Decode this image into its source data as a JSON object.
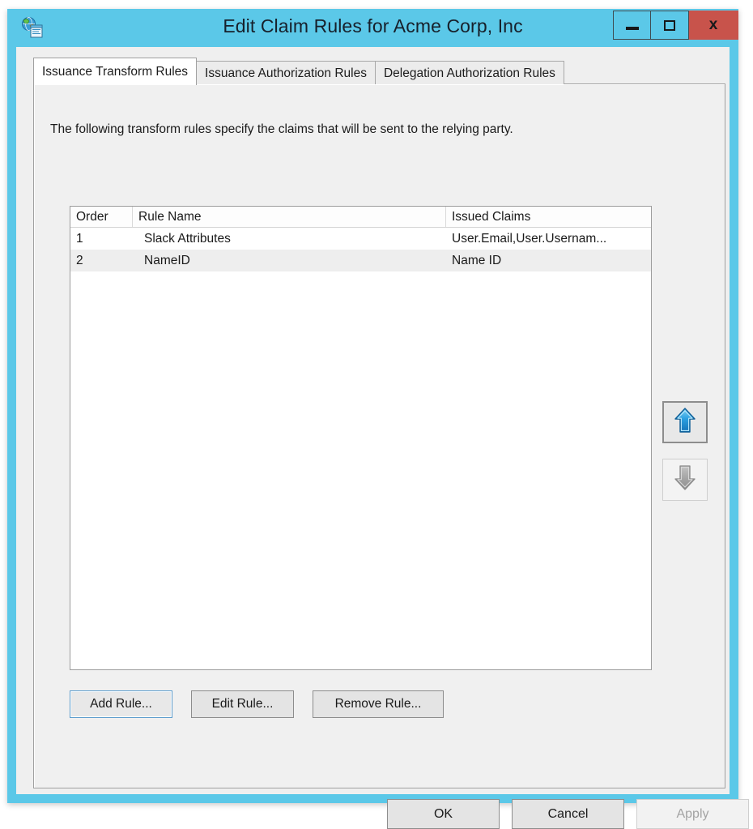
{
  "window": {
    "title": "Edit Claim Rules for Acme Corp, Inc",
    "icon": "relying-party-trust-icon",
    "accent_color": "#5bc8e8",
    "close_button_color": "#c8534b",
    "caption": {
      "minimize_label": "–",
      "maximize_label": "□",
      "close_label": "x"
    }
  },
  "tabs": [
    {
      "label": "Issuance Transform Rules",
      "active": true
    },
    {
      "label": "Issuance Authorization Rules",
      "active": false
    },
    {
      "label": "Delegation Authorization Rules",
      "active": false
    }
  ],
  "page": {
    "intro": "The following transform rules specify the claims that will be sent to the relying party."
  },
  "listview": {
    "columns": [
      {
        "key": "order",
        "label": "Order"
      },
      {
        "key": "name",
        "label": "Rule Name"
      },
      {
        "key": "claims",
        "label": "Issued Claims"
      }
    ],
    "rows": [
      {
        "order": "1",
        "name": "Slack Attributes",
        "claims": "User.Email,User.Usernam...",
        "selected": false
      },
      {
        "order": "2",
        "name": "NameID",
        "claims": "Name ID",
        "selected": true
      }
    ],
    "selection_color": "#eeeeee"
  },
  "order_controls": {
    "move_up": {
      "icon": "arrow-up-icon",
      "enabled": true,
      "color": "#2b9fe0"
    },
    "move_down": {
      "icon": "arrow-down-icon",
      "enabled": false,
      "color": "#9c9c9c"
    }
  },
  "rule_buttons": {
    "add": "Add Rule...",
    "edit": "Edit Rule...",
    "remove": "Remove Rule..."
  },
  "footer": {
    "ok": "OK",
    "cancel": "Cancel",
    "apply": "Apply",
    "apply_enabled": false
  }
}
